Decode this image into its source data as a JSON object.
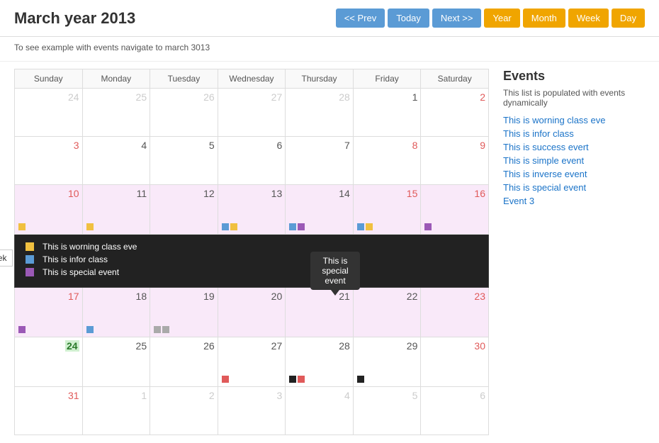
{
  "header": {
    "title": "March year 2013",
    "subtitle": "To see example with events navigate to march 3013",
    "prev_label": "<< Prev",
    "today_label": "Today",
    "next_label": "Next >>",
    "views": [
      "Year",
      "Month",
      "Week",
      "Day"
    ]
  },
  "calendar": {
    "days_of_week": [
      "Sunday",
      "Monday",
      "Tuesday",
      "Wednesday",
      "Thursday",
      "Friday",
      "Saturday"
    ],
    "weeks": [
      {
        "days": [
          {
            "num": "24",
            "faded": true,
            "red": false,
            "dots": []
          },
          {
            "num": "25",
            "faded": true,
            "red": false,
            "dots": []
          },
          {
            "num": "26",
            "faded": true,
            "red": false,
            "dots": []
          },
          {
            "num": "27",
            "faded": true,
            "red": false,
            "dots": []
          },
          {
            "num": "28",
            "faded": true,
            "red": false,
            "dots": []
          },
          {
            "num": "1",
            "faded": false,
            "red": false,
            "dots": []
          },
          {
            "num": "2",
            "faded": false,
            "red": true,
            "dots": []
          }
        ]
      },
      {
        "days": [
          {
            "num": "3",
            "faded": false,
            "red": true,
            "dots": []
          },
          {
            "num": "4",
            "faded": false,
            "red": false,
            "dots": []
          },
          {
            "num": "5",
            "faded": false,
            "red": false,
            "dots": []
          },
          {
            "num": "6",
            "faded": false,
            "red": false,
            "dots": []
          },
          {
            "num": "7",
            "faded": false,
            "red": false,
            "dots": []
          },
          {
            "num": "8",
            "faded": false,
            "red": true,
            "dots": []
          },
          {
            "num": "9",
            "faded": false,
            "red": true,
            "dots": []
          }
        ]
      },
      {
        "highlight": true,
        "days": [
          {
            "num": "10",
            "faded": false,
            "red": true,
            "dots": [
              {
                "color": "yellow"
              }
            ]
          },
          {
            "num": "11",
            "faded": false,
            "red": false,
            "dots": [
              {
                "color": "yellow"
              }
            ]
          },
          {
            "num": "12",
            "faded": false,
            "red": false,
            "dots": []
          },
          {
            "num": "13",
            "faded": false,
            "red": false,
            "dots": [
              {
                "color": "blue"
              },
              {
                "color": "yellow"
              }
            ]
          },
          {
            "num": "14",
            "faded": false,
            "red": false,
            "dots": [
              {
                "color": "blue"
              },
              {
                "color": "purple"
              }
            ],
            "tooltip": true
          },
          {
            "num": "15",
            "faded": false,
            "red": true,
            "dots": [
              {
                "color": "blue"
              },
              {
                "color": "yellow"
              }
            ]
          },
          {
            "num": "16",
            "faded": false,
            "red": true,
            "dots": [
              {
                "color": "purple"
              }
            ]
          }
        ]
      },
      {
        "expanded": true
      },
      {
        "highlight": true,
        "days": [
          {
            "num": "17",
            "faded": false,
            "red": true,
            "dots": [
              {
                "color": "purple"
              }
            ]
          },
          {
            "num": "18",
            "faded": false,
            "red": false,
            "dots": [
              {
                "color": "blue"
              }
            ]
          },
          {
            "num": "19",
            "faded": false,
            "red": false,
            "dots": [
              {
                "color": "gray"
              },
              {
                "color": "gray"
              }
            ]
          },
          {
            "num": "20",
            "faded": false,
            "red": false,
            "dots": []
          },
          {
            "num": "21",
            "faded": false,
            "red": false,
            "dots": []
          },
          {
            "num": "22",
            "faded": false,
            "red": false,
            "dots": []
          },
          {
            "num": "23",
            "faded": false,
            "red": true,
            "dots": []
          }
        ]
      },
      {
        "days": [
          {
            "num": "24",
            "faded": false,
            "red": false,
            "today": true,
            "dots": []
          },
          {
            "num": "25",
            "faded": false,
            "red": false,
            "dots": []
          },
          {
            "num": "26",
            "faded": false,
            "red": false,
            "dots": []
          },
          {
            "num": "27",
            "faded": false,
            "red": false,
            "dots": [
              {
                "color": "red"
              }
            ]
          },
          {
            "num": "28",
            "faded": false,
            "red": false,
            "dots": [
              {
                "color": "black"
              },
              {
                "color": "red"
              }
            ]
          },
          {
            "num": "29",
            "faded": false,
            "red": false,
            "dots": [
              {
                "color": "black"
              }
            ]
          },
          {
            "num": "30",
            "faded": false,
            "red": true,
            "dots": []
          }
        ]
      },
      {
        "days": [
          {
            "num": "31",
            "faded": false,
            "red": true,
            "dots": []
          },
          {
            "num": "1",
            "faded": true,
            "red": false,
            "dots": []
          },
          {
            "num": "2",
            "faded": true,
            "red": false,
            "dots": []
          },
          {
            "num": "3",
            "faded": true,
            "red": false,
            "dots": []
          },
          {
            "num": "4",
            "faded": true,
            "red": false,
            "dots": []
          },
          {
            "num": "5",
            "faded": true,
            "red": false,
            "dots": []
          },
          {
            "num": "6",
            "faded": true,
            "red": false,
            "dots": []
          }
        ]
      }
    ],
    "expanded_row": {
      "items": [
        {
          "color": "yellow",
          "label": "This is worning class eve"
        },
        {
          "color": "blue",
          "label": "This is infor class"
        },
        {
          "color": "purple",
          "label": "This is special event"
        }
      ]
    },
    "tooltip": {
      "text": "This is special event",
      "day": 14
    }
  },
  "sidebar": {
    "title": "Events",
    "description": "This list is populated with events dynamically",
    "links": [
      "This is worning class eve",
      "This is infor class",
      "This is success evert",
      "This is simple event",
      "This is inverse event",
      "This is special event",
      "Event 3"
    ]
  },
  "week_label": "Week"
}
